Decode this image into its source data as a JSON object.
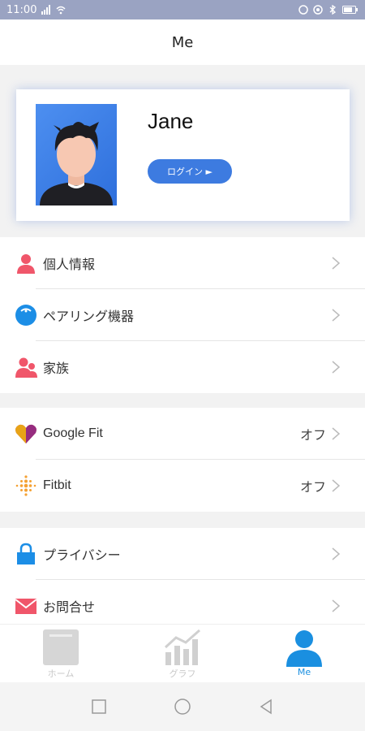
{
  "status_bar": {
    "time": "11:00"
  },
  "header": {
    "title": "Me"
  },
  "profile": {
    "name": "Jane",
    "login_label": "ログイン ►"
  },
  "menu_group_1": [
    {
      "label": "個人情報",
      "icon": "person-icon",
      "color": "#f0566a"
    },
    {
      "label": "ペアリング機器",
      "icon": "scale-icon",
      "color": "#1c8ee6"
    },
    {
      "label": "家族",
      "icon": "family-icon",
      "color": "#f0566a"
    }
  ],
  "menu_group_2": [
    {
      "label": "Google Fit",
      "value": "オフ",
      "icon": "google-fit-icon"
    },
    {
      "label": "Fitbit",
      "value": "オフ",
      "icon": "fitbit-icon",
      "color": "#f4a133"
    }
  ],
  "menu_group_3": [
    {
      "label": "プライバシー",
      "icon": "lock-icon",
      "color": "#1c8ee6"
    },
    {
      "label": "お問合せ",
      "icon": "mail-icon",
      "color": "#f0566a"
    }
  ],
  "tabs": [
    {
      "label": "ホーム",
      "icon": "home-scale-icon",
      "active": false
    },
    {
      "label": "グラフ",
      "icon": "graph-icon",
      "active": false
    },
    {
      "label": "Me",
      "icon": "me-person-icon",
      "active": true
    }
  ],
  "colors": {
    "accent": "#1a8fe0",
    "button": "#3d7be0",
    "inactive": "#c8c8c8"
  }
}
